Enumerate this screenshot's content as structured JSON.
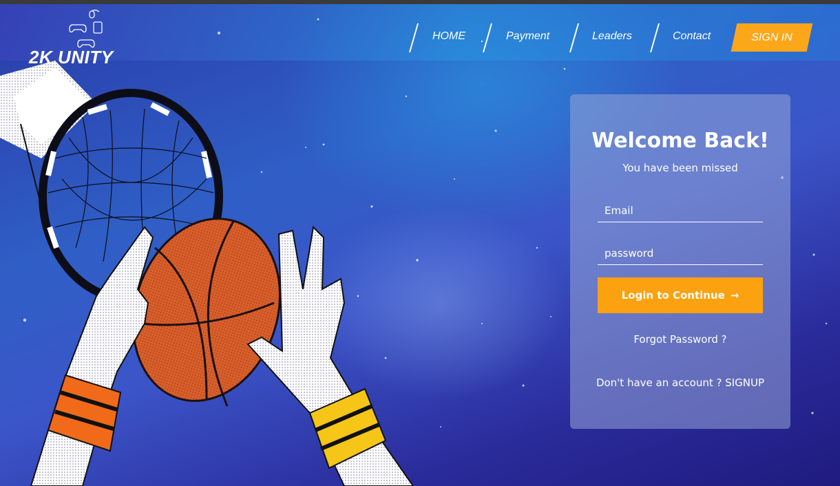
{
  "brand": {
    "name": "2K UNITY",
    "logo_icons": [
      "mouse-icon",
      "gamepad-icon",
      "console-icon",
      "controller-icon"
    ]
  },
  "nav": {
    "items": [
      "HOME",
      "Payment",
      "Leaders",
      "Contact"
    ],
    "signin_label": "SIGN IN"
  },
  "login": {
    "title": "Welcome Back!",
    "subtitle": "You have been missed",
    "email_placeholder": "Email",
    "password_placeholder": "password",
    "submit_label": "Login to Continue",
    "submit_icon": "arrow-right-icon",
    "forgot_label": "Forgot Password ?",
    "signup_label": "Don't have an account ? SIGNUP"
  },
  "colors": {
    "accent": "#fba719",
    "background_deep": "#1f1b7e",
    "background_light": "#2f8fd8",
    "card": "#8f9ccf",
    "ball": "#d95f2b",
    "wristband_left": "#f06a1a",
    "wristband_right": "#f5c518"
  }
}
